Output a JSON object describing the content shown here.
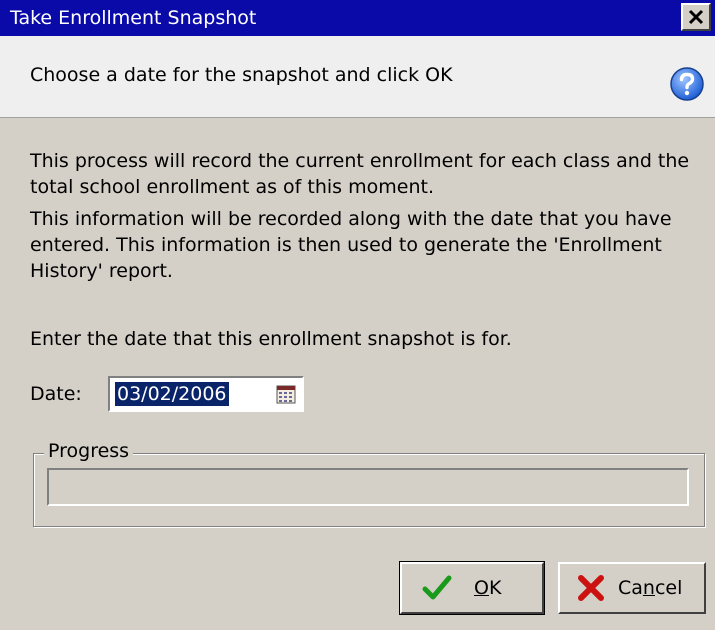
{
  "window": {
    "title": "Take Enrollment Snapshot",
    "close_glyph": "✕"
  },
  "header": {
    "instruction": "Choose a date for the snapshot and click OK",
    "help_icon": "question-mark-help-icon"
  },
  "body": {
    "paragraph_1": "This process will record the current enrollment for each class and the total school enrollment as of this moment.",
    "paragraph_2": "This information will be recorded along with the date that you have entered.  This information is then used to generate the 'Enrollment History' report.",
    "paragraph_3": "Enter the date that this enrollment snapshot is for."
  },
  "date": {
    "label": "Date:",
    "value": "03/02/2006",
    "picker_icon": "calendar-icon"
  },
  "progress": {
    "label": "Progress",
    "value": 0
  },
  "buttons": {
    "ok": {
      "label_prefix": "",
      "label_accel": "O",
      "label_rest": "K",
      "icon": "checkmark-icon"
    },
    "cancel": {
      "label_prefix": "Ca",
      "label_accel": "n",
      "label_rest": "cel",
      "icon": "red-x-icon"
    }
  },
  "colors": {
    "titlebar": "#0a0aa8",
    "selection": "#0a246a",
    "ok_check": "#1a9a1a",
    "cancel_x": "#cc1111"
  }
}
